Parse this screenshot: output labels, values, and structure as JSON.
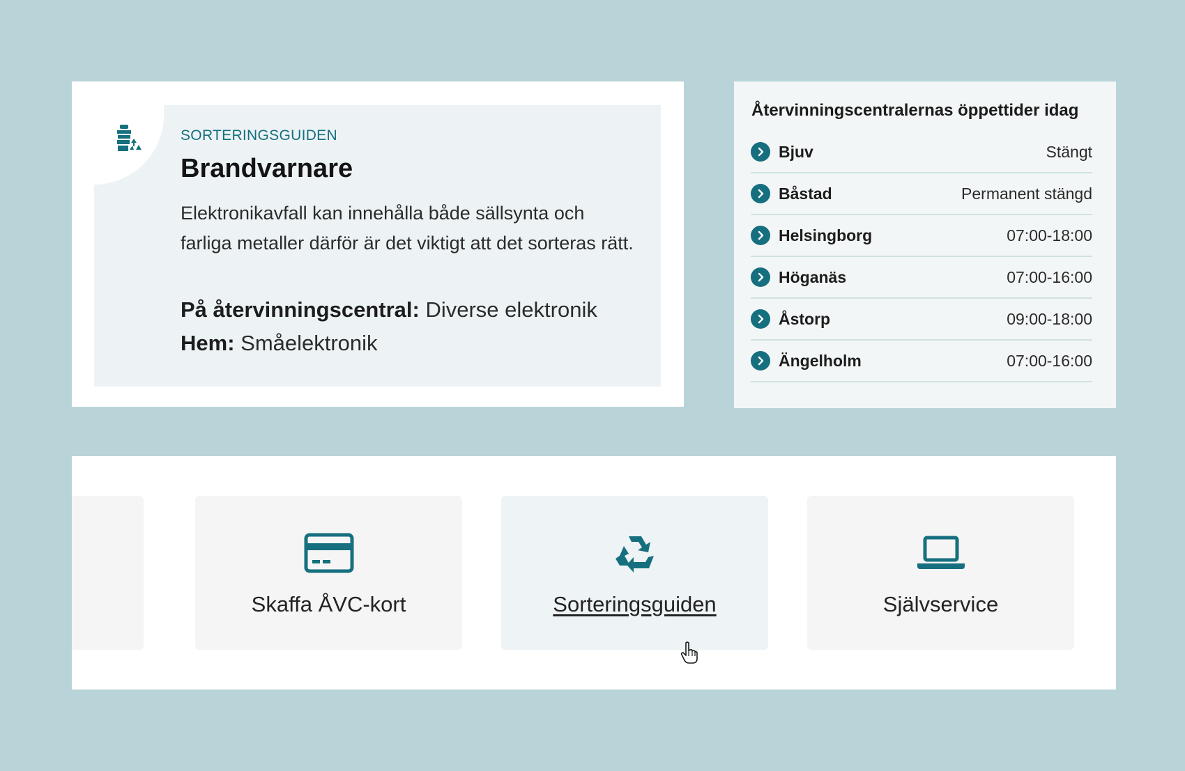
{
  "guide": {
    "kicker": "SORTERINGSGUIDEN",
    "title": "Brandvarnare",
    "description": "Elektronikavfall kan innehålla både sällsynta och farliga metaller därför är det viktigt att det sorteras rätt.",
    "recycling_center_label": "På återvinningscentral:",
    "recycling_center_value": "Diverse elektronik",
    "home_label": "Hem:",
    "home_value": "Småelektronik",
    "icon": "sorting-bin-recycle-icon"
  },
  "hours": {
    "title": "Återvinningscentralernas öppettider idag",
    "rows": [
      {
        "name": "Bjuv",
        "time": "Stängt"
      },
      {
        "name": "Båstad",
        "time": "Permanent stängd"
      },
      {
        "name": "Helsingborg",
        "time": "07:00-18:00"
      },
      {
        "name": "Höganäs",
        "time": "07:00-16:00"
      },
      {
        "name": "Åstorp",
        "time": "09:00-18:00"
      },
      {
        "name": "Ängelholm",
        "time": "07:00-16:00"
      }
    ]
  },
  "links": {
    "tiles": [
      {
        "label": "Skaffa ÅVC-kort",
        "icon": "card-icon"
      },
      {
        "label": "Sorteringsguiden",
        "icon": "recycle-icon"
      },
      {
        "label": "Självservice",
        "icon": "laptop-icon"
      }
    ]
  },
  "colors": {
    "background": "#b9d4d8",
    "accent": "#156f7e",
    "guide_panel": "#edf3f5"
  }
}
